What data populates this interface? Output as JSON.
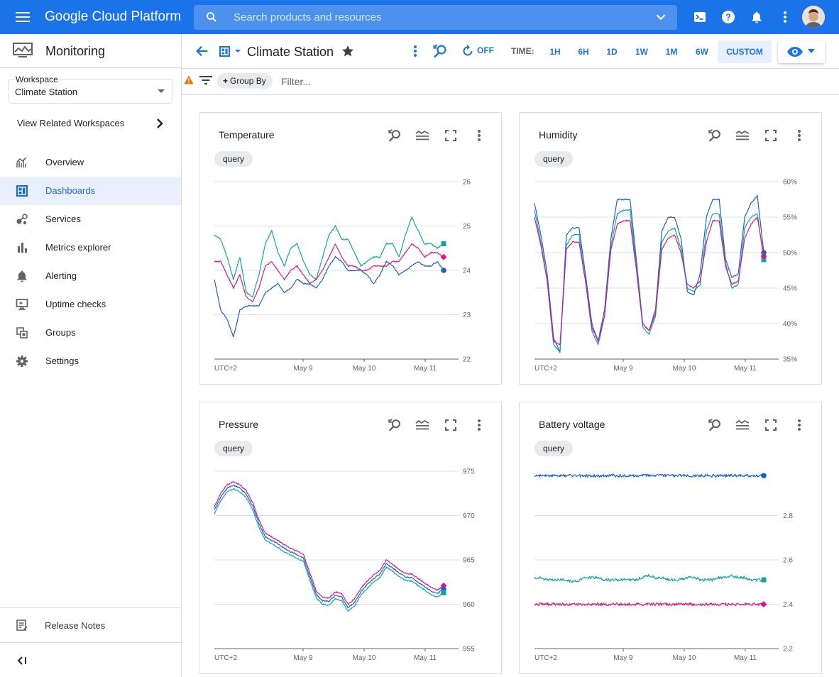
{
  "topbar": {
    "product_name": "Google Cloud Platform",
    "search_placeholder": "Search products and resources"
  },
  "sidebar": {
    "product": "Monitoring",
    "workspace_label": "Workspace",
    "workspace_value": "Climate Station",
    "related": "View Related Workspaces",
    "items": [
      {
        "label": "Overview",
        "icon": "overview-icon"
      },
      {
        "label": "Dashboards",
        "icon": "dashboards-icon",
        "active": true
      },
      {
        "label": "Services",
        "icon": "services-icon"
      },
      {
        "label": "Metrics explorer",
        "icon": "metrics-explorer-icon"
      },
      {
        "label": "Alerting",
        "icon": "bell-icon"
      },
      {
        "label": "Uptime checks",
        "icon": "uptime-checks-icon"
      },
      {
        "label": "Groups",
        "icon": "groups-icon"
      },
      {
        "label": "Settings",
        "icon": "gear-icon"
      }
    ],
    "release_notes": "Release Notes"
  },
  "dashboard": {
    "title": "Climate Station",
    "refresh": "OFF",
    "time_label": "TIME:",
    "time_options": [
      "1H",
      "6H",
      "1D",
      "1W",
      "1M",
      "6W",
      "CUSTOM"
    ],
    "time_selected": "CUSTOM"
  },
  "filterbar": {
    "group_by": "Group By",
    "filter_placeholder": "Filter..."
  },
  "colors": {
    "accent": "#1a73e8",
    "series_blue": "#1a5fd0",
    "series_teal": "#12a4a4",
    "series_magenta": "#d6188c"
  },
  "chart_data": [
    {
      "type": "line",
      "title": "Temperature",
      "chip": "query",
      "timezone_label": "UTC+2",
      "x_ticks": [
        "May 9",
        "May 10",
        "May 11"
      ],
      "y_ticks": [
        "26",
        "25",
        "24",
        "23",
        "22"
      ],
      "ylim": [
        22,
        26
      ],
      "series": [
        {
          "color": "#12a4a4",
          "values": [
            24.8,
            24.7,
            24.3,
            23.8,
            24.3,
            23.5,
            23.4,
            23.9,
            24.6,
            24.9,
            24.4,
            24.1,
            24.5,
            24.6,
            24.2,
            23.9,
            23.8,
            24.3,
            24.8,
            25.0,
            24.7,
            24.7,
            24.4,
            24.1,
            24.2,
            24.3,
            24.3,
            24.6,
            24.6,
            24.3,
            24.8,
            25.2,
            24.9,
            24.6,
            24.6,
            24.5,
            24.6
          ]
        },
        {
          "color": "#d6188c",
          "values": [
            24.2,
            24.2,
            23.9,
            23.6,
            23.9,
            23.4,
            23.3,
            23.6,
            24.1,
            24.2,
            24.0,
            23.8,
            24.0,
            24.1,
            23.9,
            23.7,
            23.8,
            24.0,
            24.3,
            24.6,
            24.3,
            24.1,
            24.1,
            24.0,
            24.0,
            24.1,
            24.1,
            24.1,
            24.2,
            24.2,
            24.4,
            24.6,
            24.5,
            24.3,
            24.4,
            24.4,
            24.3
          ]
        },
        {
          "color": "#1a5fd0",
          "values": [
            23.8,
            23.1,
            22.9,
            22.5,
            23.1,
            23.2,
            23.2,
            23.2,
            23.5,
            23.6,
            23.7,
            23.5,
            23.6,
            23.8,
            23.7,
            23.7,
            23.6,
            23.8,
            24.1,
            24.3,
            24.2,
            24.0,
            24.0,
            24.0,
            23.9,
            23.7,
            23.9,
            24.2,
            24.1,
            23.9,
            24.0,
            24.1,
            24.2,
            24.1,
            24.1,
            24.2,
            24.0
          ]
        }
      ]
    },
    {
      "type": "line",
      "title": "Humidity",
      "chip": "query",
      "timezone_label": "UTC+2",
      "x_ticks": [
        "May 9",
        "May 10",
        "May 11"
      ],
      "y_ticks": [
        "60%",
        "55%",
        "50%",
        "45%",
        "40%",
        "35%"
      ],
      "ylim": [
        35,
        60
      ],
      "series": [
        {
          "color": "#1a5fd0",
          "values": [
            57.0,
            52.5,
            47,
            38,
            36,
            52.5,
            53.5,
            53.5,
            47,
            40,
            37.5,
            42,
            52,
            57.5,
            57.5,
            57.5,
            49,
            40,
            39,
            42,
            53,
            55,
            55,
            52,
            44.5,
            44,
            47,
            55,
            57.5,
            57.5,
            49,
            46.5,
            47,
            55,
            57,
            58,
            50
          ]
        },
        {
          "color": "#12a4a4",
          "values": [
            56.0,
            51.5,
            46,
            37,
            36,
            51,
            52.5,
            52.5,
            46,
            39,
            37,
            41,
            51,
            55.5,
            56,
            56,
            48,
            39.5,
            38.5,
            41,
            51.5,
            53,
            53.5,
            50.5,
            45,
            44.5,
            45.5,
            53,
            55.5,
            55.5,
            48.5,
            45,
            45.5,
            53.5,
            55,
            55.5,
            49
          ]
        },
        {
          "color": "#d6188c",
          "values": [
            55.0,
            51,
            46,
            37.5,
            37,
            50.5,
            51.5,
            51.5,
            46,
            39.5,
            37.5,
            41,
            50.5,
            54,
            54.5,
            54.5,
            47.5,
            40,
            39,
            41.5,
            50.5,
            52,
            52.5,
            50,
            45.5,
            45,
            46,
            51.5,
            54.5,
            54.5,
            48,
            45.5,
            46,
            52,
            54,
            55,
            49.5
          ]
        }
      ]
    },
    {
      "type": "line",
      "title": "Pressure",
      "chip": "query",
      "timezone_label": "UTC+2",
      "x_ticks": [
        "May 9",
        "May 10",
        "May 11"
      ],
      "y_ticks": [
        "975",
        "970",
        "965",
        "960",
        "955"
      ],
      "ylim": [
        955,
        975
      ],
      "series": [
        {
          "color": "#d6188c",
          "values": [
            971.0,
            972.5,
            973.5,
            973.8,
            973.5,
            972.8,
            971.5,
            969.5,
            968.0,
            967.6,
            967.2,
            966.7,
            966.3,
            966.0,
            965.6,
            963.5,
            961.5,
            960.8,
            960.7,
            961.4,
            961.2,
            960.0,
            960.6,
            961.8,
            962.6,
            963.3,
            963.8,
            965.0,
            964.5,
            963.9,
            963.5,
            963.4,
            962.9,
            962.4,
            961.9,
            961.6,
            962.1
          ]
        },
        {
          "color": "#1a5fd0",
          "values": [
            970.6,
            972.1,
            973.1,
            973.4,
            973.1,
            972.4,
            971.1,
            969.1,
            967.6,
            967.2,
            966.8,
            966.3,
            965.9,
            965.6,
            965.2,
            963.1,
            961.1,
            960.4,
            960.3,
            961.0,
            960.8,
            959.6,
            960.2,
            961.4,
            962.2,
            962.9,
            963.4,
            964.6,
            964.1,
            963.5,
            963.1,
            963.0,
            962.5,
            962.0,
            961.5,
            961.2,
            961.7
          ]
        },
        {
          "color": "#12a4a4",
          "values": [
            970.2,
            971.7,
            972.7,
            973.0,
            972.7,
            972.0,
            970.7,
            968.7,
            967.2,
            966.8,
            966.4,
            965.9,
            965.5,
            965.2,
            964.8,
            962.7,
            960.7,
            960.0,
            959.9,
            960.6,
            960.4,
            959.2,
            959.8,
            961.0,
            961.8,
            962.5,
            963.0,
            964.2,
            963.7,
            963.1,
            962.7,
            962.6,
            962.1,
            961.6,
            961.1,
            960.8,
            961.3
          ]
        }
      ]
    },
    {
      "type": "line",
      "title": "Battery voltage",
      "chip": "query",
      "timezone_label": "UTC+2",
      "x_ticks": [
        "May 9",
        "May 10",
        "May 11"
      ],
      "y_ticks": [
        "2.8",
        "2.6",
        "2.4",
        "2.2"
      ],
      "ylim": [
        2.2,
        3.0
      ],
      "series": [
        {
          "color": "#1a5fd0",
          "values": [
            2.98,
            2.98,
            2.98,
            2.98,
            2.98,
            2.98,
            2.98,
            2.98,
            2.98,
            2.98,
            2.98,
            2.98,
            2.98,
            2.98,
            2.98,
            2.98,
            2.98,
            2.98,
            2.98,
            2.98,
            2.98,
            2.98,
            2.98,
            2.98,
            2.98,
            2.98,
            2.98,
            2.98,
            2.98,
            2.98,
            2.98,
            2.98,
            2.98,
            2.98,
            2.98,
            2.98,
            2.98
          ]
        },
        {
          "color": "#12a4a4",
          "values": [
            2.52,
            2.52,
            2.51,
            2.51,
            2.51,
            2.51,
            2.5,
            2.51,
            2.52,
            2.52,
            2.52,
            2.51,
            2.51,
            2.51,
            2.51,
            2.51,
            2.51,
            2.52,
            2.53,
            2.52,
            2.52,
            2.51,
            2.51,
            2.51,
            2.52,
            2.52,
            2.51,
            2.51,
            2.51,
            2.52,
            2.52,
            2.53,
            2.52,
            2.52,
            2.51,
            2.51,
            2.51
          ]
        },
        {
          "color": "#d6188c",
          "values": [
            2.4,
            2.4,
            2.4,
            2.4,
            2.4,
            2.4,
            2.4,
            2.4,
            2.4,
            2.4,
            2.4,
            2.4,
            2.4,
            2.4,
            2.4,
            2.4,
            2.4,
            2.4,
            2.4,
            2.4,
            2.4,
            2.4,
            2.4,
            2.4,
            2.4,
            2.4,
            2.4,
            2.4,
            2.4,
            2.4,
            2.4,
            2.4,
            2.4,
            2.4,
            2.4,
            2.4,
            2.4
          ]
        }
      ]
    }
  ]
}
